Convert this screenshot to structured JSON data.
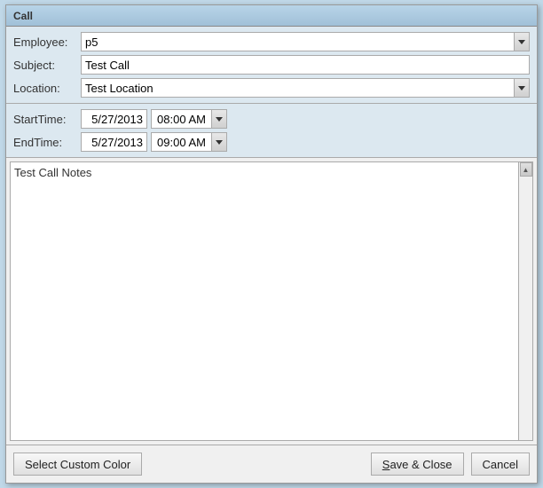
{
  "window": {
    "title": "Call"
  },
  "form": {
    "employee_label": "Employee:",
    "employee_value": "p5",
    "subject_label": "Subject:",
    "subject_value": "Test Call",
    "location_label": "Location:",
    "location_value": "Test Location"
  },
  "times": {
    "start_label": "StartTime:",
    "start_date": "5/27/2013",
    "start_time": "08:00 AM",
    "end_label": "EndTime:",
    "end_date": "5/27/2013",
    "end_time": "09:00 AM"
  },
  "notes": {
    "content": "Test Call Notes"
  },
  "footer": {
    "custom_color_label": "Select Custom Color",
    "save_close_label": "Save & Close",
    "cancel_label": "Cancel"
  }
}
